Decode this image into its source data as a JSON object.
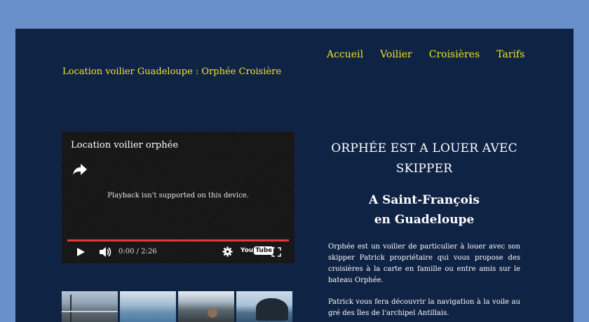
{
  "site": {
    "title": "Location voilier Guadeloupe : Orphée Croisière"
  },
  "nav": {
    "items": [
      "Accueil",
      "Voilier",
      "Croisières",
      "Tarifs"
    ]
  },
  "video": {
    "title": "Location voilier orphée",
    "playback_message": "Playback isn't supported on this device.",
    "time": "0:00 / 2:26",
    "logo_you": "You",
    "logo_tube": "Tube",
    "icons": [
      "share-icon",
      "play-icon",
      "volume-icon",
      "gear-icon",
      "fullscreen-icon"
    ],
    "progress_color": "#e53935"
  },
  "content": {
    "headline": "ORPHÉE EST A LOUER AVEC SKIPPER",
    "subhead_line1": "A Saint-François",
    "subhead_line2": "en Guadeloupe",
    "paragraph1": "Orphée est un voilier de particulier à louer avec son skipper Patrick propriétaire qui vous propose des croisières à la carte en famille ou entre amis sur le bateau Orphée.",
    "paragraph2": "Patrick vous fera découvrir la navigation à la voile au gré des îles de l'archipel Antillais."
  },
  "colors": {
    "accent": "#f1e52a",
    "page_bg": "#6a90cc",
    "frame_bg": "#0f2344"
  }
}
